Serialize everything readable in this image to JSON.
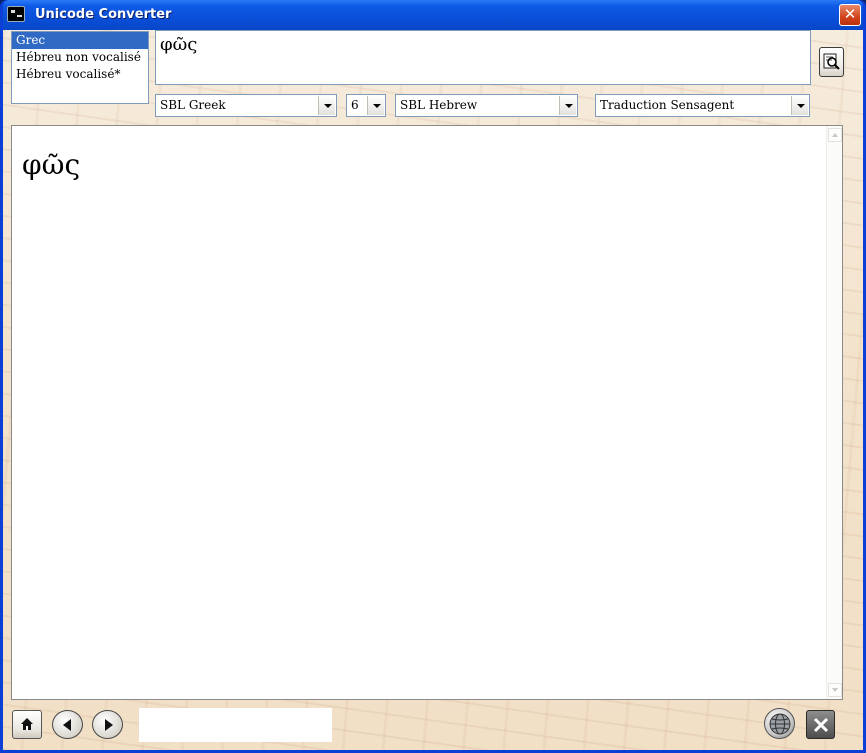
{
  "window": {
    "title": "Unicode Converter"
  },
  "languages": {
    "items": [
      {
        "label": "Grec",
        "selected": true
      },
      {
        "label": "Hébreu non vocalisé",
        "selected": false
      },
      {
        "label": "Hébreu vocalisé*",
        "selected": false
      }
    ]
  },
  "input": {
    "value": "φῶς"
  },
  "combos": {
    "greek_font": "SBL Greek",
    "size": "6",
    "hebrew_font": "SBL Hebrew",
    "translation": "Traduction Sensagent"
  },
  "output": {
    "text": "φῶς"
  },
  "icons": {
    "search": "search-icon",
    "home": "home-icon",
    "back": "arrow-left-icon",
    "forward": "arrow-right-icon",
    "globe": "globe-icon",
    "close": "close-icon"
  },
  "colors": {
    "title_bar": "#0a4fd8",
    "selection": "#316ac5",
    "close_red": "#d2431c"
  }
}
